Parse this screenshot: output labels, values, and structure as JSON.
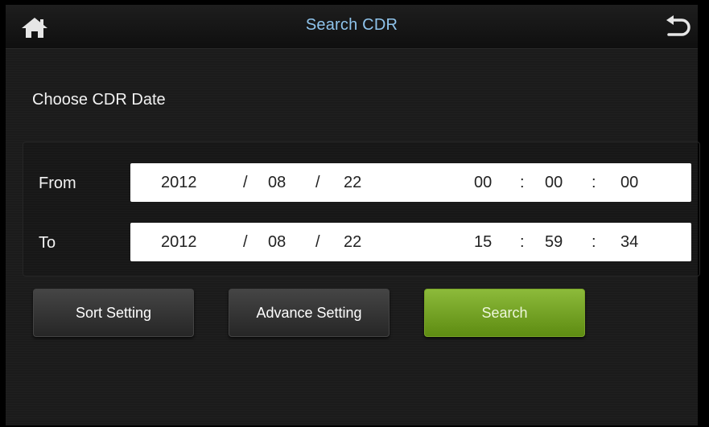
{
  "header": {
    "title": "Search CDR",
    "home_icon": "home-icon",
    "back_icon": "back-arrow-icon",
    "title_color": "#8fc4ec"
  },
  "section_title": "Choose CDR Date",
  "date_range": {
    "from": {
      "label": "From",
      "year": "2012",
      "month": "08",
      "day": "22",
      "hour": "00",
      "minute": "00",
      "second": "00"
    },
    "to": {
      "label": "To",
      "year": "2012",
      "month": "08",
      "day": "22",
      "hour": "15",
      "minute": "59",
      "second": "34"
    },
    "date_separator": "/",
    "time_separator": ":"
  },
  "buttons": {
    "sort": "Sort Setting",
    "advance": "Advance Setting",
    "search": "Search"
  },
  "colors": {
    "search_button": "#6e9c1e",
    "background": "#1b1b1b"
  }
}
